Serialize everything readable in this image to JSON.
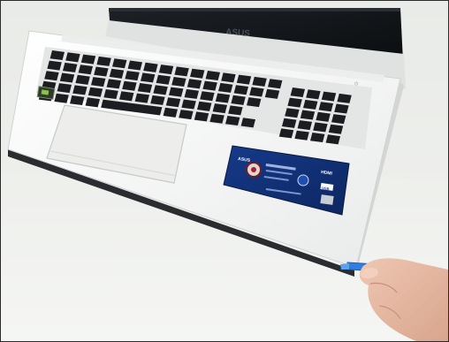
{
  "photo": {
    "lid_logo": "ASUS",
    "sticker": {
      "brand": "ASUS",
      "ports": [
        "HDMI",
        "USB"
      ]
    },
    "keyboard": {
      "key_rows": [
        15,
        15,
        14,
        13,
        11
      ],
      "numpad": {
        "columns": 4,
        "rows": 5
      }
    },
    "colors": {
      "wall": "#eef0ed",
      "table": "#f2f3f1",
      "chassis": "#f7f8f7",
      "keys": "#1b1d21",
      "sticker": "#1c3f8f",
      "pry_tool": "#2f7ee0",
      "hand": "#e6b9a3"
    }
  }
}
